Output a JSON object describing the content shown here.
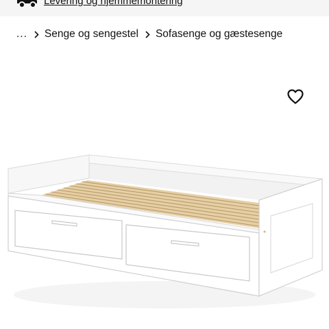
{
  "topbar": {
    "delivery_link_text": "Levering og hjemmemontering"
  },
  "breadcrumb": {
    "ellipsis": "...",
    "items": [
      {
        "label": "Senge og sengestel"
      },
      {
        "label": "Sofasenge og gæstesenge"
      }
    ]
  },
  "icons": {
    "truck": "truck-icon",
    "separator": "chevron-right-icon",
    "favorite": "heart-outline-icon"
  },
  "colors": {
    "topbar_bg": "#f5f5f5",
    "text": "#111111",
    "bed_frame": "#ffffff",
    "slats": "#e6cfa4"
  }
}
